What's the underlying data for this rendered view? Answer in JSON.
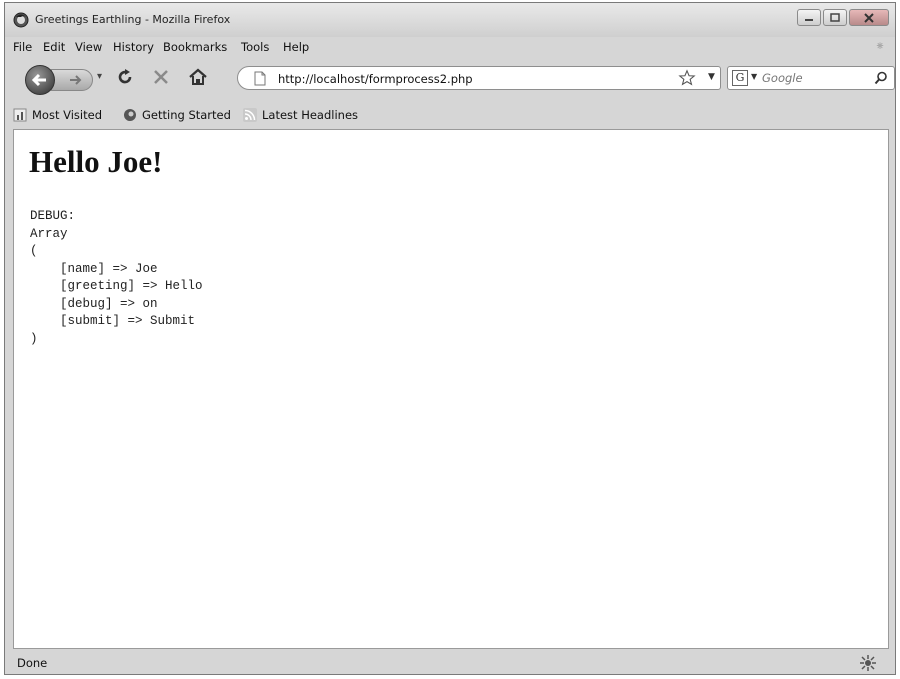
{
  "window": {
    "title": "Greetings Earthling - Mozilla Firefox"
  },
  "menu": [
    "File",
    "Edit",
    "View",
    "History",
    "Bookmarks",
    "Tools",
    "Help"
  ],
  "nav": {
    "url": "http://localhost/formprocess2.php",
    "search_placeholder": "Google"
  },
  "bookmarks": [
    "Most Visited",
    "Getting Started",
    "Latest Headlines"
  ],
  "content": {
    "heading": "Hello Joe!",
    "debug": "DEBUG:\nArray\n(\n    [name] => Joe\n    [greeting] => Hello\n    [debug] => on\n    [submit] => Submit\n)"
  },
  "status": {
    "text": "Done"
  },
  "icons": {
    "firefox": "firefox-logo-icon",
    "back": "back-arrow-icon",
    "forward": "forward-arrow-icon",
    "reload": "reload-icon",
    "stop": "stop-icon",
    "home": "home-icon",
    "page": "page-icon",
    "star": "star-icon",
    "search": "magnifier-icon",
    "throbber": "throbber-icon",
    "status": "addon-icon"
  }
}
